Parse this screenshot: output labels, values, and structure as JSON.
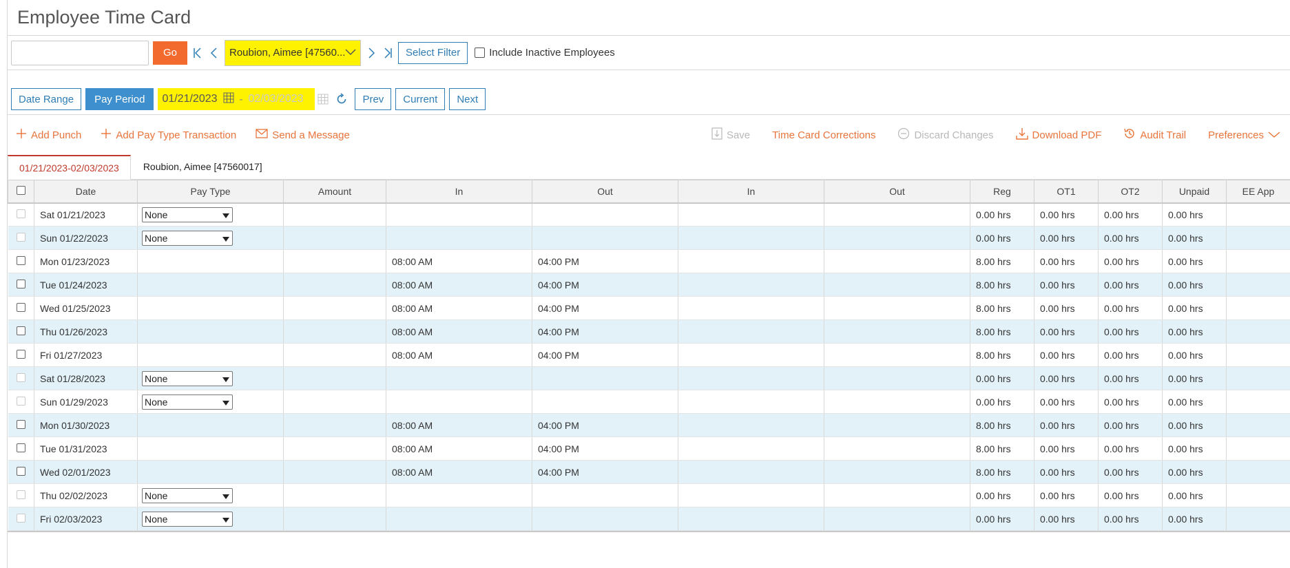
{
  "header": {
    "title": "Employee Time Card"
  },
  "filter": {
    "search_value": "",
    "go_label": "Go",
    "employee_selected": "Roubion, Aimee [47560...",
    "select_filter_label": "Select Filter",
    "include_inactive_label": "Include Inactive Employees"
  },
  "period": {
    "date_range_label": "Date Range",
    "pay_period_label": "Pay Period",
    "start_date": "01/21/2023",
    "separator": "-",
    "end_date": "02/03/2023",
    "prev_label": "Prev",
    "current_label": "Current",
    "next_label": "Next"
  },
  "actions": {
    "add_punch": "Add Punch",
    "add_pay_type": "Add Pay Type Transaction",
    "send_message": "Send a Message",
    "save": "Save",
    "corrections": "Time Card Corrections",
    "discard": "Discard Changes",
    "download_pdf": "Download PDF",
    "audit_trail": "Audit Trail",
    "preferences": "Preferences"
  },
  "tabs": {
    "period_tab": "01/21/2023-02/03/2023",
    "employee_tab": "Roubion, Aimee [47560017]"
  },
  "table": {
    "columns": [
      "Date",
      "Pay Type",
      "Amount",
      "In",
      "Out",
      "In",
      "Out",
      "Reg",
      "OT1",
      "OT2",
      "Unpaid",
      "EE App"
    ],
    "rows": [
      {
        "date": "Sat 01/21/2023",
        "pay_type": "None",
        "amount": "",
        "in1": "",
        "out1": "",
        "in2": "",
        "out2": "",
        "reg": "0.00 hrs",
        "ot1": "0.00 hrs",
        "ot2": "0.00 hrs",
        "unpaid": "0.00 hrs",
        "ee_app": ""
      },
      {
        "date": "Sun 01/22/2023",
        "pay_type": "None",
        "amount": "",
        "in1": "",
        "out1": "",
        "in2": "",
        "out2": "",
        "reg": "0.00 hrs",
        "ot1": "0.00 hrs",
        "ot2": "0.00 hrs",
        "unpaid": "0.00 hrs",
        "ee_app": ""
      },
      {
        "date": "Mon 01/23/2023",
        "pay_type": "",
        "amount": "",
        "in1": "08:00 AM",
        "out1": "04:00 PM",
        "in2": "",
        "out2": "",
        "reg": "8.00 hrs",
        "ot1": "0.00 hrs",
        "ot2": "0.00 hrs",
        "unpaid": "0.00 hrs",
        "ee_app": ""
      },
      {
        "date": "Tue 01/24/2023",
        "pay_type": "",
        "amount": "",
        "in1": "08:00 AM",
        "out1": "04:00 PM",
        "in2": "",
        "out2": "",
        "reg": "8.00 hrs",
        "ot1": "0.00 hrs",
        "ot2": "0.00 hrs",
        "unpaid": "0.00 hrs",
        "ee_app": ""
      },
      {
        "date": "Wed 01/25/2023",
        "pay_type": "",
        "amount": "",
        "in1": "08:00 AM",
        "out1": "04:00 PM",
        "in2": "",
        "out2": "",
        "reg": "8.00 hrs",
        "ot1": "0.00 hrs",
        "ot2": "0.00 hrs",
        "unpaid": "0.00 hrs",
        "ee_app": ""
      },
      {
        "date": "Thu 01/26/2023",
        "pay_type": "",
        "amount": "",
        "in1": "08:00 AM",
        "out1": "04:00 PM",
        "in2": "",
        "out2": "",
        "reg": "8.00 hrs",
        "ot1": "0.00 hrs",
        "ot2": "0.00 hrs",
        "unpaid": "0.00 hrs",
        "ee_app": ""
      },
      {
        "date": "Fri 01/27/2023",
        "pay_type": "",
        "amount": "",
        "in1": "08:00 AM",
        "out1": "04:00 PM",
        "in2": "",
        "out2": "",
        "reg": "8.00 hrs",
        "ot1": "0.00 hrs",
        "ot2": "0.00 hrs",
        "unpaid": "0.00 hrs",
        "ee_app": ""
      },
      {
        "date": "Sat 01/28/2023",
        "pay_type": "None",
        "amount": "",
        "in1": "",
        "out1": "",
        "in2": "",
        "out2": "",
        "reg": "0.00 hrs",
        "ot1": "0.00 hrs",
        "ot2": "0.00 hrs",
        "unpaid": "0.00 hrs",
        "ee_app": ""
      },
      {
        "date": "Sun 01/29/2023",
        "pay_type": "None",
        "amount": "",
        "in1": "",
        "out1": "",
        "in2": "",
        "out2": "",
        "reg": "0.00 hrs",
        "ot1": "0.00 hrs",
        "ot2": "0.00 hrs",
        "unpaid": "0.00 hrs",
        "ee_app": ""
      },
      {
        "date": "Mon 01/30/2023",
        "pay_type": "",
        "amount": "",
        "in1": "08:00 AM",
        "out1": "04:00 PM",
        "in2": "",
        "out2": "",
        "reg": "8.00 hrs",
        "ot1": "0.00 hrs",
        "ot2": "0.00 hrs",
        "unpaid": "0.00 hrs",
        "ee_app": ""
      },
      {
        "date": "Tue 01/31/2023",
        "pay_type": "",
        "amount": "",
        "in1": "08:00 AM",
        "out1": "04:00 PM",
        "in2": "",
        "out2": "",
        "reg": "8.00 hrs",
        "ot1": "0.00 hrs",
        "ot2": "0.00 hrs",
        "unpaid": "0.00 hrs",
        "ee_app": ""
      },
      {
        "date": "Wed 02/01/2023",
        "pay_type": "",
        "amount": "",
        "in1": "08:00 AM",
        "out1": "04:00 PM",
        "in2": "",
        "out2": "",
        "reg": "8.00 hrs",
        "ot1": "0.00 hrs",
        "ot2": "0.00 hrs",
        "unpaid": "0.00 hrs",
        "ee_app": ""
      },
      {
        "date": "Thu 02/02/2023",
        "pay_type": "None",
        "amount": "",
        "in1": "",
        "out1": "",
        "in2": "",
        "out2": "",
        "reg": "0.00 hrs",
        "ot1": "0.00 hrs",
        "ot2": "0.00 hrs",
        "unpaid": "0.00 hrs",
        "ee_app": ""
      },
      {
        "date": "Fri 02/03/2023",
        "pay_type": "None",
        "amount": "",
        "in1": "",
        "out1": "",
        "in2": "",
        "out2": "",
        "reg": "0.00 hrs",
        "ot1": "0.00 hrs",
        "ot2": "0.00 hrs",
        "unpaid": "0.00 hrs",
        "ee_app": ""
      }
    ]
  },
  "colors": {
    "accent_orange": "#f26a2e",
    "action_orange": "#e8743b",
    "primary_blue": "#3d8fcd",
    "highlight_yellow": "#fff200",
    "row_shade": "#e3f1f8",
    "tab_red": "#c0392b"
  }
}
